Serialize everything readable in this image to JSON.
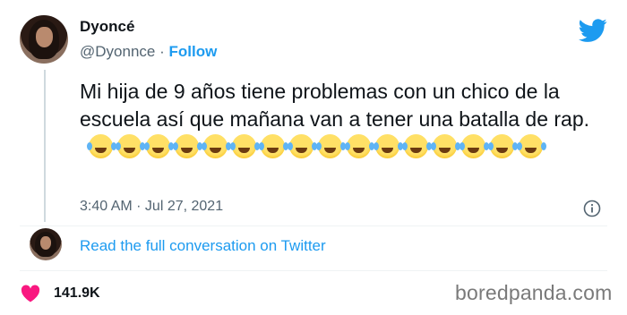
{
  "author": {
    "name": "Dyoncé",
    "handle": "@Dyonnce",
    "separator": "·",
    "follow_label": "Follow"
  },
  "tweet": {
    "text": "Mi hija de 9 años tiene problemas con un chico de la escuela así que mañana van a tener una batalla de rap.",
    "emoji_name": "face-with-tears-of-joy",
    "emoji_count": 16,
    "timestamp": "3:40 AM · Jul 27, 2021"
  },
  "conversation": {
    "link_label": "Read the full conversation on Twitter"
  },
  "engagement": {
    "likes": "141.9K"
  },
  "watermark": "boredpanda.com",
  "icons": {
    "brand": "twitter-bird-icon",
    "info": "info-icon",
    "like": "heart-icon"
  },
  "colors": {
    "twitter_blue": "#1d9bf0",
    "text_primary": "#0f1419",
    "text_secondary": "#536471",
    "heart_pink": "#f91880"
  }
}
